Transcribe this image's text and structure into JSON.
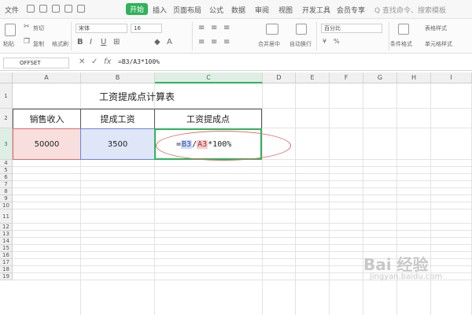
{
  "menu": {
    "file_label": "文件",
    "tabs": [
      "开始",
      "插入",
      "页面布局",
      "公式",
      "数据",
      "审阅",
      "视图",
      "开发工具",
      "会员专享"
    ],
    "search": "Q 查找命令、搜索模板"
  },
  "ribbon": {
    "paste": "粘贴",
    "cut": "剪切",
    "copy": "复制",
    "format_painter": "格式刷",
    "font_name": "宋体",
    "font_size": "16",
    "merge_center": "合并居中",
    "wrap_text": "自动换行",
    "number_format": "百分比",
    "conditional_format": "条件格式",
    "table_style": "表格样式",
    "cell_style": "单元格样式"
  },
  "formula_bar": {
    "name_box": "OFFSET",
    "cancel_icon": "✕",
    "confirm_icon": "✓",
    "fx_label": "fx",
    "formula": "=B3/A3*100%"
  },
  "columns": [
    "A",
    "B",
    "C",
    "D",
    "E",
    "F",
    "G",
    "H",
    "I"
  ],
  "rows": [
    "1",
    "2",
    "3",
    "4",
    "5",
    "6",
    "7",
    "8",
    "9",
    "10",
    "11",
    "12",
    "13",
    "14",
    "15",
    "16",
    "17",
    "18",
    "19"
  ],
  "sheet": {
    "title": "工资提成点计算表",
    "headers": [
      "销售收入",
      "提成工资",
      "工资提成点"
    ],
    "a3": "50000",
    "b3": "3500",
    "c3_eq": "=",
    "c3_ref1": "B3",
    "c3_div": "/",
    "c3_ref2": "A3",
    "c3_tail": "*100%"
  },
  "watermark": {
    "logo": "Bai 经验",
    "url": "jingyan.baidu.com"
  },
  "colors": {
    "accent": "#2fb25a",
    "ref_a": "#f8dedd",
    "ref_b": "#dfe6f8",
    "annotation": "#e06666"
  }
}
